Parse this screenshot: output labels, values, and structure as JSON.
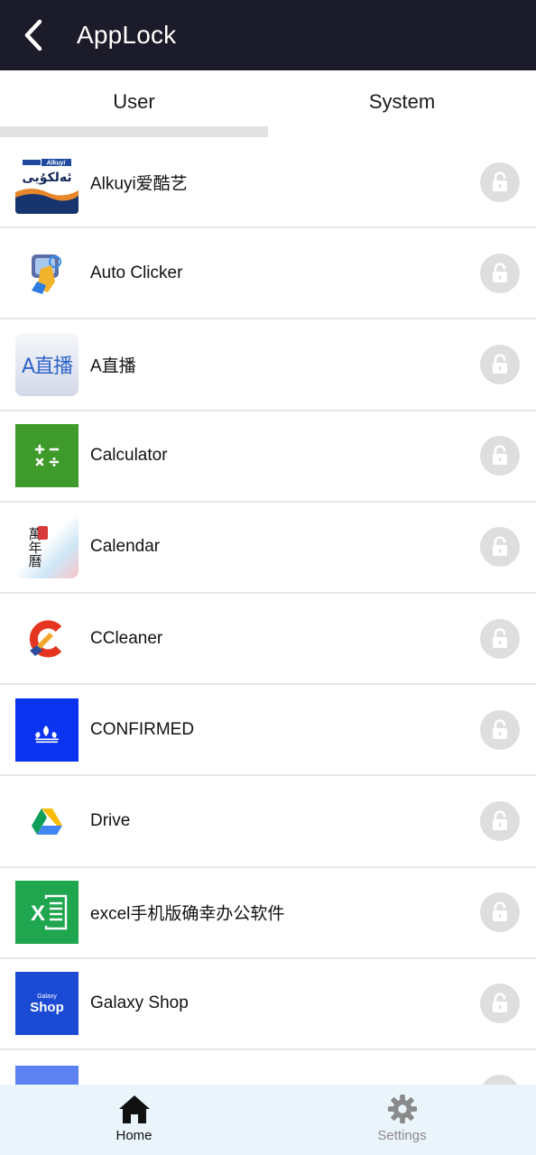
{
  "appbar": {
    "title": "AppLock"
  },
  "tabs": [
    {
      "label": "User",
      "selected": true
    },
    {
      "label": "System",
      "selected": false
    }
  ],
  "apps": [
    {
      "name": "Alkuyi爱酷艺",
      "icon": "alkuyi-icon",
      "locked": false
    },
    {
      "name": "Auto Clicker",
      "icon": "auto-clicker-icon",
      "locked": false
    },
    {
      "name": "A直播",
      "icon": "a-live-icon",
      "locked": false
    },
    {
      "name": "Calculator",
      "icon": "calculator-icon",
      "locked": false
    },
    {
      "name": "Calendar",
      "icon": "calendar-icon",
      "locked": false
    },
    {
      "name": "CCleaner",
      "icon": "ccleaner-icon",
      "locked": false
    },
    {
      "name": "CONFIRMED",
      "icon": "adidas-icon",
      "locked": false
    },
    {
      "name": "Drive",
      "icon": "drive-icon",
      "locked": false
    },
    {
      "name": "excel手机版确幸办公软件",
      "icon": "excel-icon",
      "locked": false
    },
    {
      "name": "Galaxy Shop",
      "icon": "galaxy-shop-icon",
      "locked": false
    }
  ],
  "icon_text": {
    "alkuyi_brand": "Alkuyi",
    "alkuyi_script": "ئەلكۇيى",
    "a_live": "A直播",
    "calendar_chars": "萬年曆",
    "galaxy_small": "Galaxy",
    "galaxy_shop": "Shop",
    "excel_letter": "X"
  },
  "bottom_nav": [
    {
      "label": "Home",
      "icon": "home-icon",
      "active": true
    },
    {
      "label": "Settings",
      "icon": "gear-icon",
      "active": false
    }
  ],
  "colors": {
    "appbar_bg": "#1c1b29",
    "tab_indicator": "#e2e2e2",
    "lock_bg": "#dedede",
    "bottom_nav_bg": "#eaf5fb"
  }
}
